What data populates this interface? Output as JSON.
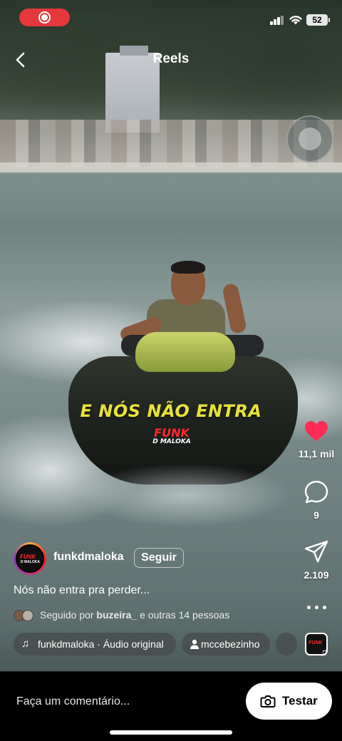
{
  "status_bar": {
    "battery": "52"
  },
  "header": {
    "title": "Reels"
  },
  "video": {
    "caption_text": "E NÓS NÃO ENTRA",
    "logo_line1": "FUNK",
    "logo_line2": "D MALOKA"
  },
  "actions": {
    "likes": "11,1 mil",
    "comments": "9",
    "shares": "2.109"
  },
  "author": {
    "username": "funkdmaloka",
    "follow_label": "Seguir",
    "avatar_line1": "FUNK",
    "avatar_line2": "D MALOKA"
  },
  "post": {
    "caption": "Nós não entra pra perder...",
    "followed_by_prefix": "Seguido por",
    "followed_by_user": "buzeira_",
    "followed_by_suffix": "e outras 14 pessoas"
  },
  "chips": {
    "audio": "funkdmaloka · Áudio original",
    "tagged_user": "mccebezinho"
  },
  "bottom_bar": {
    "comment_placeholder": "Faça um comentário...",
    "try_label": "Testar"
  },
  "colors": {
    "like_heart": "#ff2d55",
    "record_pill": "#e5383b",
    "caption_yellow": "#e8e23a"
  },
  "icons": [
    "back-icon",
    "record-icon",
    "signal-icon",
    "wifi-icon",
    "battery-icon",
    "heart-icon",
    "comment-icon",
    "share-icon",
    "more-icon",
    "music-note-icon",
    "person-icon",
    "camera-icon"
  ]
}
